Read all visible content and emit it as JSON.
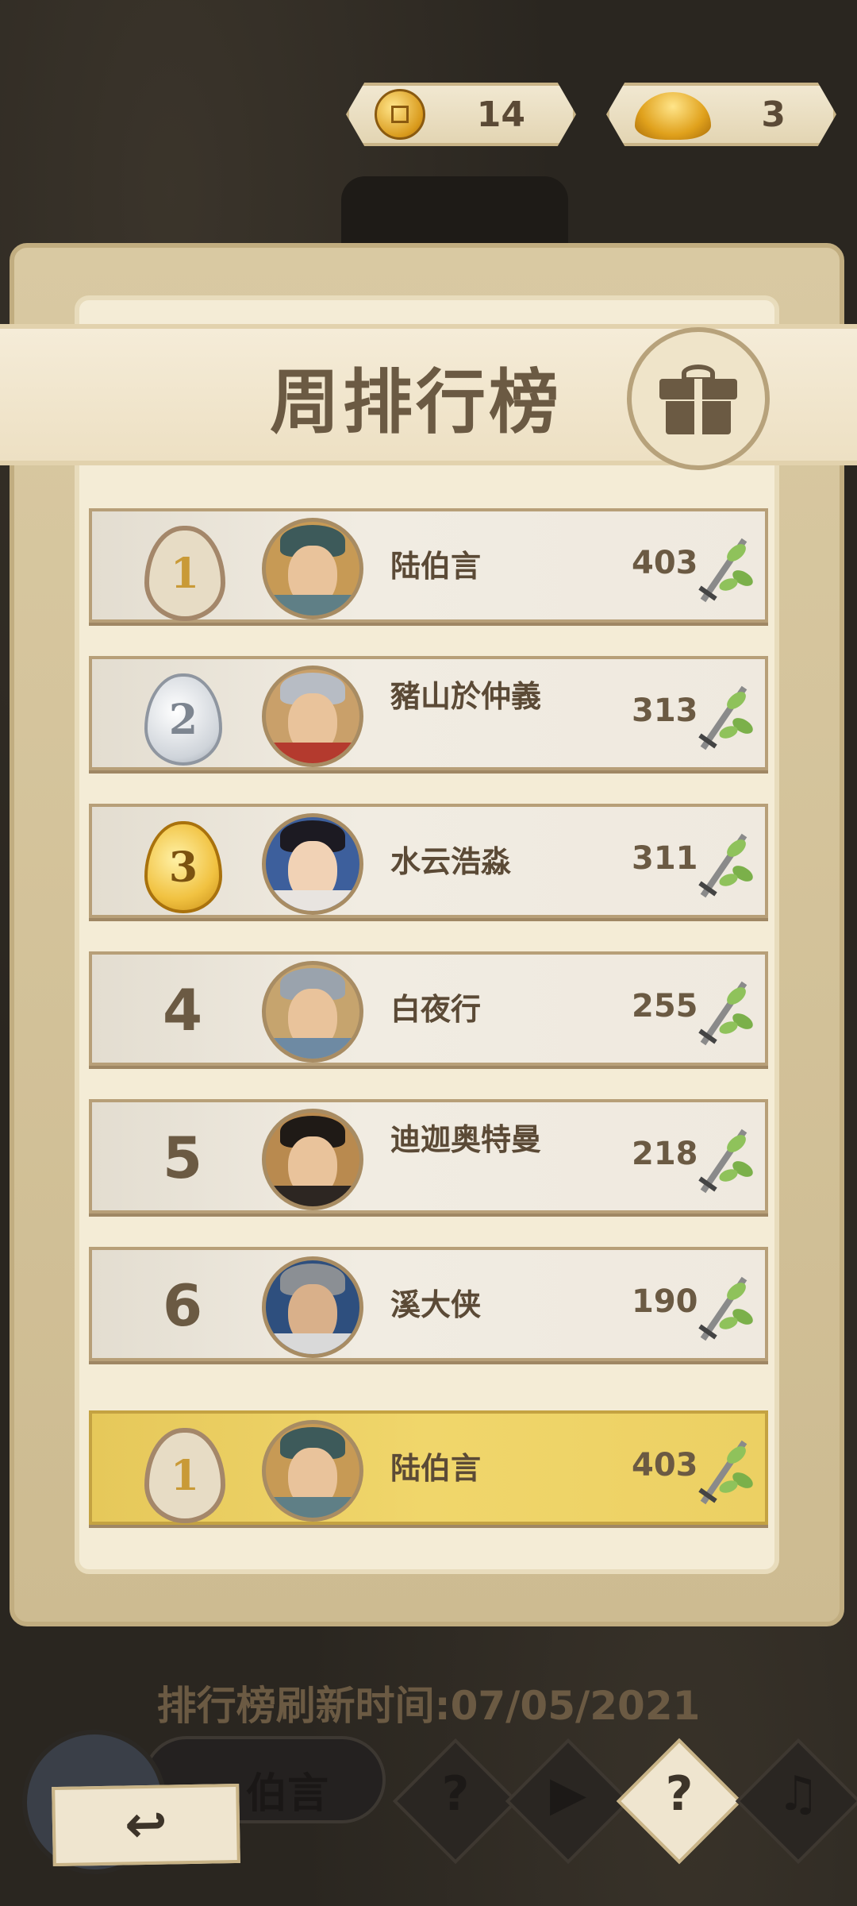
{
  "currency": {
    "coins": "14",
    "ingots": "3"
  },
  "title": "周排行榜",
  "rows": [
    {
      "rank": "1",
      "name": "陆伯言",
      "score": "403"
    },
    {
      "rank": "2",
      "name": "豬山於仲義",
      "score": "313"
    },
    {
      "rank": "3",
      "name": "水云浩淼",
      "score": "311"
    },
    {
      "rank": "4",
      "name": "白夜行",
      "score": "255"
    },
    {
      "rank": "5",
      "name": "迪迦奥特曼",
      "score": "218"
    },
    {
      "rank": "6",
      "name": "溪大侠",
      "score": "190"
    }
  ],
  "self_row": {
    "rank": "1",
    "name": "陆伯言",
    "score": "403"
  },
  "refresh_time": "排行榜刷新时间:07/05/2021",
  "bottom_bar": {
    "player_name": "伯言",
    "buttons": [
      {
        "icon": "help-icon",
        "glyph": "?"
      },
      {
        "icon": "video-icon",
        "glyph": "▶"
      },
      {
        "icon": "help-icon",
        "glyph": "?"
      },
      {
        "icon": "music-icon",
        "glyph": "♫"
      }
    ]
  },
  "colors": {
    "brand_brown": "#6b5a43",
    "self_highlight": "#f0d66b",
    "panel_bg": "#f4ecd6"
  }
}
